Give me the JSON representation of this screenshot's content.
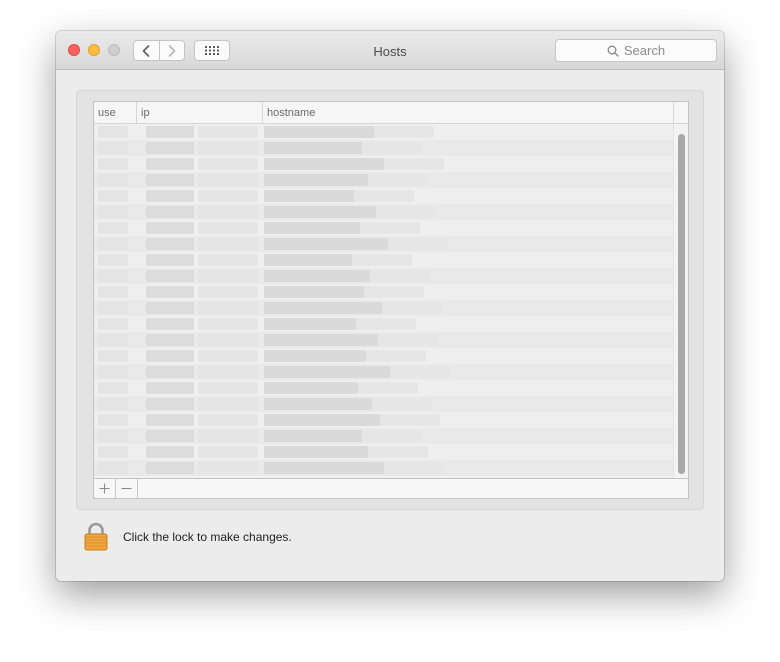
{
  "window": {
    "title": "Hosts",
    "search_placeholder": "Search"
  },
  "icons": {
    "back": "chevron-left-icon",
    "forward": "chevron-right-icon",
    "grid": "grid-icon",
    "search": "search-icon",
    "lock": "lock-icon",
    "add": "plus-icon",
    "remove": "minus-icon"
  },
  "table": {
    "columns": [
      {
        "label": "use"
      },
      {
        "label": "ip"
      },
      {
        "label": "hostname"
      }
    ],
    "scroll_position": 0
  },
  "footer": {
    "add_label": "+",
    "remove_label": "−"
  },
  "lock": {
    "label": "Click the lock to make changes."
  },
  "colors": {
    "close": "#fc605c",
    "minimize": "#fdbc40",
    "zoom": "#cfcfcf",
    "lock_body": "#f2a540"
  }
}
